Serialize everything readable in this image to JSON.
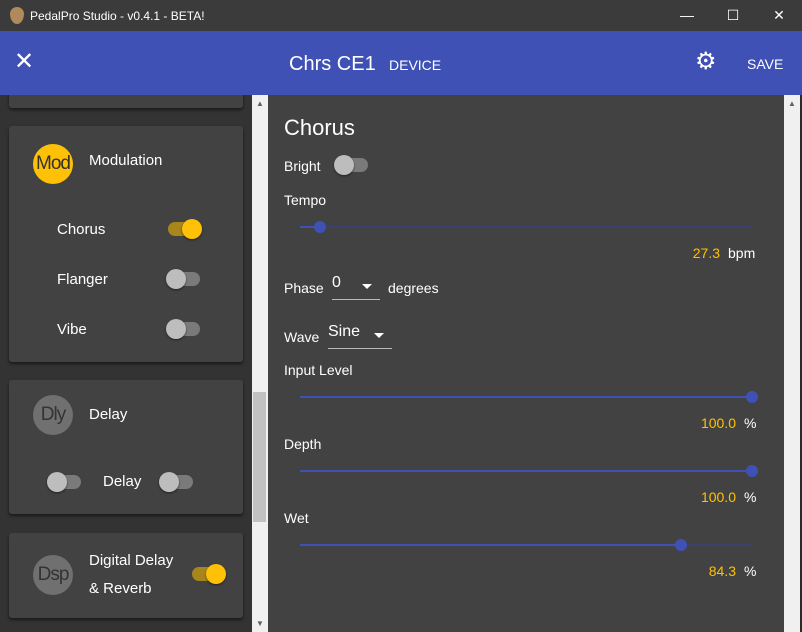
{
  "window": {
    "title": "PedalPro Studio - v0.4.1 - BETA!",
    "minimize": "—",
    "maximize": "☐",
    "close": "✕"
  },
  "appbar": {
    "close_icon": "✕",
    "title": "Chrs CE1",
    "subtitle": "DEVICE",
    "gear_icon": "⚙",
    "save_label": "SAVE"
  },
  "sidebar": {
    "modulation": {
      "avatar": "Mod",
      "title": "Modulation",
      "avatar_color": "#ffc107",
      "items": [
        {
          "label": "Chorus",
          "on": true
        },
        {
          "label": "Flanger",
          "on": false
        },
        {
          "label": "Vibe",
          "on": false
        }
      ]
    },
    "delay": {
      "avatar": "Dly",
      "title": "Delay",
      "left_toggle_on": false,
      "item": {
        "label": "Delay",
        "on": false
      }
    },
    "dsp": {
      "avatar": "Dsp",
      "title_line1": "Digital Delay",
      "title_line2": "& Reverb",
      "on": true
    }
  },
  "editor": {
    "title": "Chorus",
    "bright": {
      "label": "Bright",
      "on": false
    },
    "tempo": {
      "label": "Tempo",
      "value": "27.3",
      "unit": "bpm",
      "fraction": 0.045
    },
    "phase": {
      "label": "Phase",
      "value": "0",
      "unit": "degrees"
    },
    "wave": {
      "label": "Wave",
      "value": "Sine"
    },
    "input_level": {
      "label": "Input Level",
      "value": "100.0",
      "unit": "%",
      "fraction": 1.0
    },
    "depth": {
      "label": "Depth",
      "value": "100.0",
      "unit": "%",
      "fraction": 1.0
    },
    "wet": {
      "label": "Wet",
      "value": "84.3",
      "unit": "%",
      "fraction": 0.843
    }
  },
  "colors": {
    "primary": "#3f51b5",
    "accent": "#ffc107"
  }
}
